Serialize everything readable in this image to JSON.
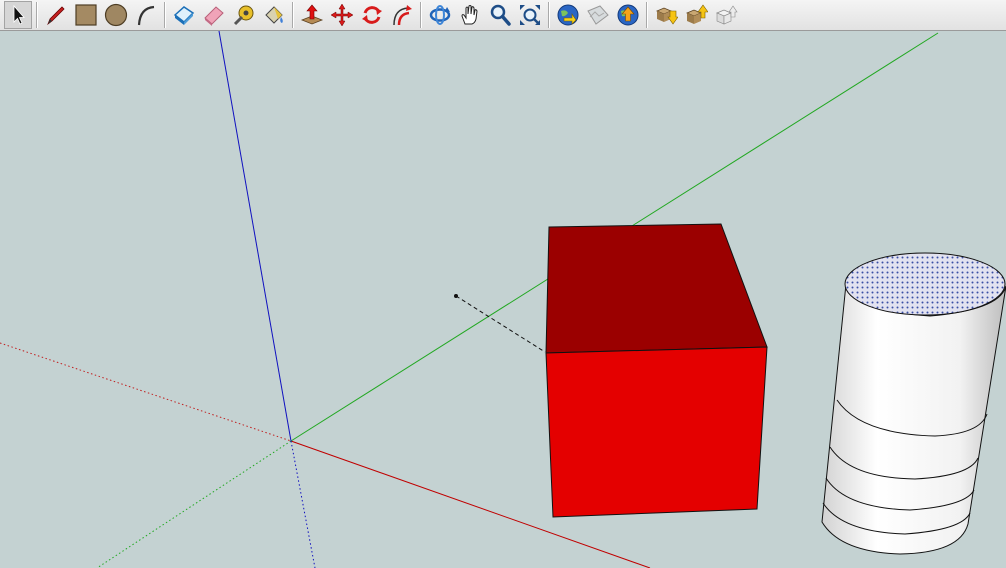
{
  "toolbar": {
    "tools": [
      {
        "name": "select-tool",
        "icon": "arrow-cursor-icon",
        "active": true
      },
      {
        "name": "line-tool",
        "icon": "pencil-icon"
      },
      {
        "name": "rectangle-tool",
        "icon": "rectangle-icon"
      },
      {
        "name": "circle-tool",
        "icon": "circle-icon"
      },
      {
        "name": "arc-tool",
        "icon": "arc-icon"
      },
      {
        "name": "make-component-tool",
        "icon": "component-icon"
      },
      {
        "name": "eraser-tool",
        "icon": "eraser-icon"
      },
      {
        "name": "tape-measure-tool",
        "icon": "tape-measure-icon"
      },
      {
        "name": "paint-bucket-tool",
        "icon": "paint-bucket-icon"
      },
      {
        "name": "push-pull-tool",
        "icon": "push-pull-icon"
      },
      {
        "name": "move-tool",
        "icon": "move-icon"
      },
      {
        "name": "rotate-tool",
        "icon": "rotate-icon"
      },
      {
        "name": "offset-tool",
        "icon": "offset-icon"
      },
      {
        "name": "orbit-tool",
        "icon": "orbit-icon"
      },
      {
        "name": "pan-tool",
        "icon": "hand-icon"
      },
      {
        "name": "zoom-tool",
        "icon": "magnifier-icon"
      },
      {
        "name": "zoom-extents-tool",
        "icon": "zoom-extents-icon"
      },
      {
        "name": "get-current-view-tool",
        "icon": "globe-view-icon"
      },
      {
        "name": "toggle-terrain-tool",
        "icon": "terrain-icon"
      },
      {
        "name": "place-model-tool",
        "icon": "globe-upload-icon"
      },
      {
        "name": "get-models-tool",
        "icon": "download-models-icon"
      },
      {
        "name": "share-model-tool",
        "icon": "share-model-icon"
      },
      {
        "name": "share-component-tool",
        "icon": "share-component-icon"
      }
    ]
  },
  "colors": {
    "background": "#c4d2d2",
    "axis_red": "#c00000",
    "axis_green": "#22a822",
    "axis_blue": "#1010c0",
    "box_top": "#9b0000",
    "box_front": "#e40000",
    "cylinder_top": "#c8c8e6",
    "cylinder_body": "#ffffff"
  }
}
